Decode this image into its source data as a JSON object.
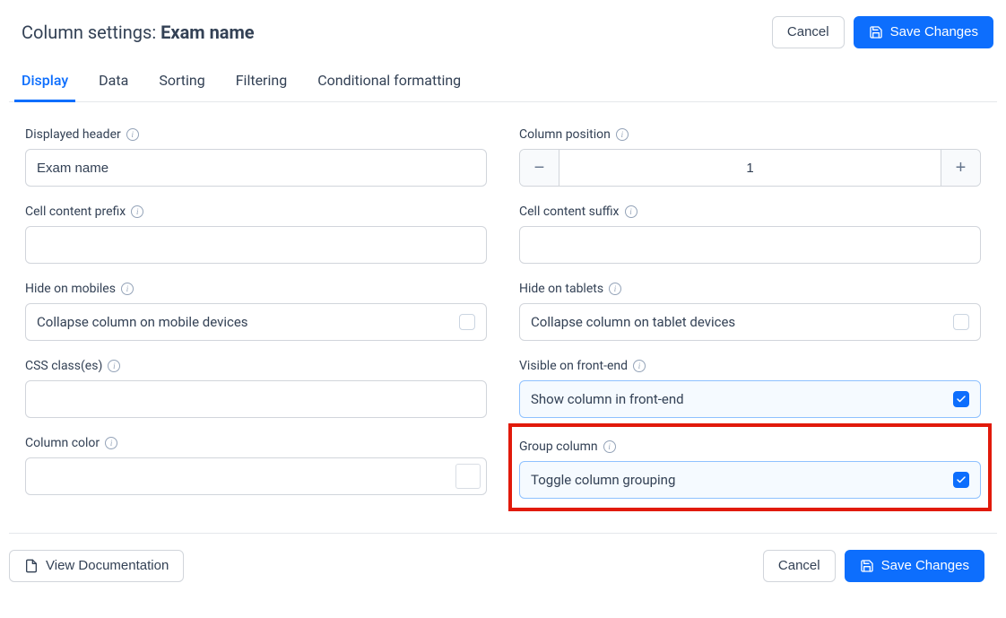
{
  "header": {
    "title_prefix": "Column settings: ",
    "title_value": "Exam name"
  },
  "buttons": {
    "cancel": "Cancel",
    "save": "Save Changes",
    "view_docs": "View Documentation"
  },
  "tabs": [
    {
      "label": "Display",
      "active": true
    },
    {
      "label": "Data",
      "active": false
    },
    {
      "label": "Sorting",
      "active": false
    },
    {
      "label": "Filtering",
      "active": false
    },
    {
      "label": "Conditional formatting",
      "active": false
    }
  ],
  "fields": {
    "displayed_header": {
      "label": "Displayed header",
      "value": "Exam name"
    },
    "column_position": {
      "label": "Column position",
      "value": "1"
    },
    "cell_content_prefix": {
      "label": "Cell content prefix",
      "value": ""
    },
    "cell_content_suffix": {
      "label": "Cell content suffix",
      "value": ""
    },
    "hide_on_mobiles": {
      "label": "Hide on mobiles",
      "text": "Collapse column on mobile devices",
      "checked": false
    },
    "hide_on_tablets": {
      "label": "Hide on tablets",
      "text": "Collapse column on tablet devices",
      "checked": false
    },
    "css_classes": {
      "label": "CSS class(es)",
      "value": ""
    },
    "visible_on_frontend": {
      "label": "Visible on front-end",
      "text": "Show column in front-end",
      "checked": true
    },
    "column_color": {
      "label": "Column color"
    },
    "group_column": {
      "label": "Group column",
      "text": "Toggle column grouping",
      "checked": true
    }
  }
}
